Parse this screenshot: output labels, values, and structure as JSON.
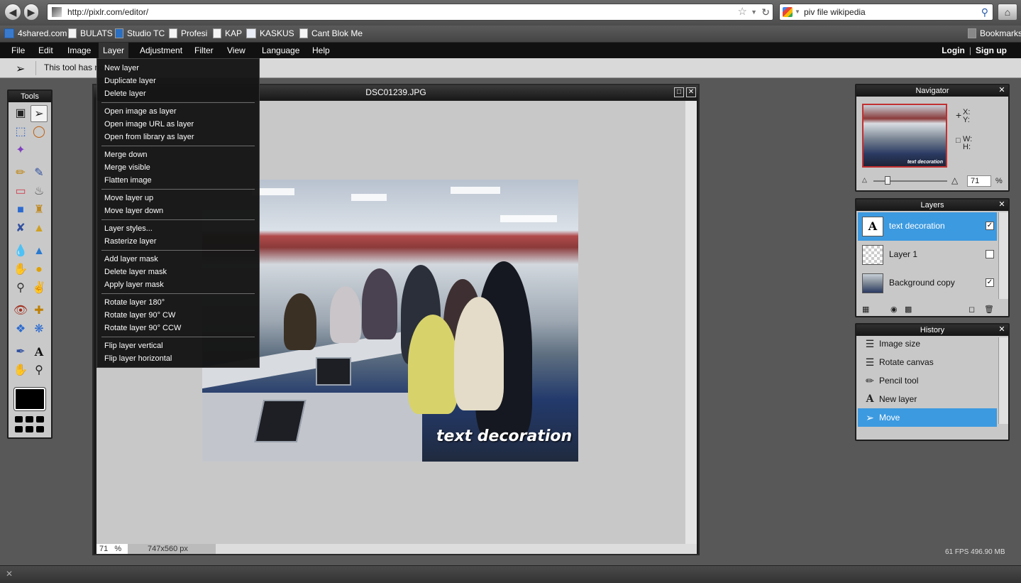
{
  "browser": {
    "url": "http://pixlr.com/editor/",
    "search_value": "piv file wikipedia",
    "back_icon": "arrow-left-icon",
    "forward_icon": "arrow-right-icon",
    "home_icon": "home-icon",
    "bookmarks_label": "Bookmarks",
    "bookmarks": [
      "4shared.com",
      "BULATS",
      "Studio TC",
      "Profesi",
      "KAP",
      "KASKUS",
      "Cant Blok Me"
    ]
  },
  "menu": {
    "items": [
      "File",
      "Edit",
      "Image",
      "Layer",
      "Adjustment",
      "Filter",
      "View",
      "Language",
      "Help"
    ],
    "active": "Layer",
    "login": "Login",
    "signup": "Sign up"
  },
  "options_bar": {
    "text": "This tool has no options"
  },
  "tools": {
    "title": "Tools",
    "foreground_color": "#000000"
  },
  "layer_menu": {
    "groups": [
      [
        "New layer",
        "Duplicate layer",
        "Delete layer"
      ],
      [
        "Open image as layer",
        "Open image URL as layer",
        "Open from library as layer"
      ],
      [
        "Merge down",
        "Merge visible",
        "Flatten image"
      ],
      [
        "Move layer up",
        "Move layer down"
      ],
      [
        "Layer styles...",
        "Rasterize layer"
      ],
      [
        "Add layer mask",
        "Delete layer mask",
        "Apply layer mask"
      ],
      [
        "Rotate layer 180°",
        "Rotate layer 90° CW",
        "Rotate layer 90° CCW"
      ],
      [
        "Flip layer vertical",
        "Flip layer horizontal"
      ]
    ]
  },
  "document": {
    "title": "DSC01239.JPG",
    "zoom": "71",
    "zoom_unit": "%",
    "size": "747x560 px",
    "caption": "text decoration"
  },
  "navigator": {
    "title": "Navigator",
    "x_label": "X:",
    "y_label": "Y:",
    "w_label": "W:",
    "h_label": "H:",
    "zoom_value": "71",
    "zoom_unit": "%",
    "thumb_caption": "text decoration"
  },
  "layers": {
    "title": "Layers",
    "items": [
      {
        "name": "text decoration",
        "visible": true,
        "selected": true,
        "thumb": "A"
      },
      {
        "name": "Layer 1",
        "visible": false,
        "selected": false,
        "thumb": ""
      },
      {
        "name": "Background copy",
        "visible": true,
        "selected": false,
        "thumb": ""
      }
    ]
  },
  "history": {
    "title": "History",
    "items": [
      {
        "name": "Image size",
        "icon": "image-size-icon",
        "selected": false
      },
      {
        "name": "Rotate canvas",
        "icon": "rotate-canvas-icon",
        "selected": false
      },
      {
        "name": "Pencil tool",
        "icon": "pencil-icon",
        "selected": false
      },
      {
        "name": "New layer",
        "icon": "type-icon",
        "selected": false
      },
      {
        "name": "Move",
        "icon": "move-icon",
        "selected": true
      }
    ]
  },
  "status": {
    "fps": "61 FPS 496.90 MB"
  },
  "colors": {
    "menu_bg": "#111111",
    "selection": "#3c9ae0",
    "panel_bg": "#c8c8c8"
  }
}
